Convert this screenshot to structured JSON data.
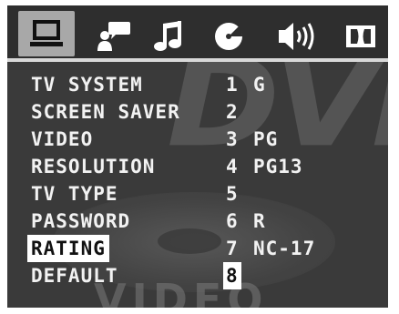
{
  "tabs": [
    {
      "id": "general",
      "icon": "monitor-icon",
      "active": true
    },
    {
      "id": "language",
      "icon": "speech-person-icon",
      "active": false
    },
    {
      "id": "audio",
      "icon": "music-note-icon",
      "active": false
    },
    {
      "id": "display",
      "icon": "disc-icon",
      "active": false
    },
    {
      "id": "speaker",
      "icon": "speaker-icon",
      "active": false
    },
    {
      "id": "dolby",
      "icon": "dolby-icon",
      "active": false
    }
  ],
  "watermark": {
    "top": "DVD",
    "bottom": "VIDEO"
  },
  "menu": {
    "items": [
      {
        "label": "TV SYSTEM"
      },
      {
        "label": "SCREEN SAVER"
      },
      {
        "label": "VIDEO"
      },
      {
        "label": "RESOLUTION"
      },
      {
        "label": "TV TYPE"
      },
      {
        "label": "PASSWORD"
      },
      {
        "label": "RATING",
        "selected": true
      },
      {
        "label": "DEFAULT"
      }
    ],
    "rating_options": [
      {
        "num": "1",
        "label": "G"
      },
      {
        "num": "2",
        "label": ""
      },
      {
        "num": "3",
        "label": "PG"
      },
      {
        "num": "4",
        "label": "PG13"
      },
      {
        "num": "5",
        "label": ""
      },
      {
        "num": "6",
        "label": "R"
      },
      {
        "num": "7",
        "label": "NC-17"
      },
      {
        "num": "8",
        "label": "",
        "selected": true
      }
    ]
  },
  "colors": {
    "background": "#3a3a3a",
    "active_tab": "#a8a8a8",
    "text": "#f2f2f2",
    "highlight": "#ffffff"
  }
}
